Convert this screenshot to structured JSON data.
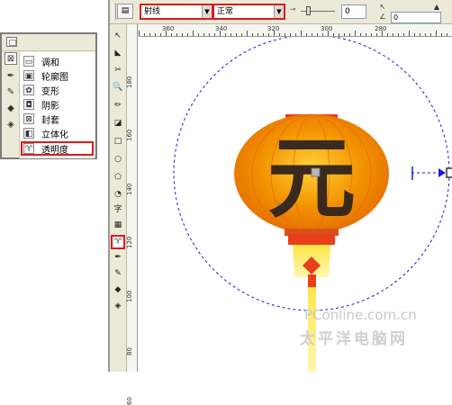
{
  "flyout": {
    "items": [
      {
        "label": "调和",
        "icon": "blend-icon",
        "glyph": "▭"
      },
      {
        "label": "轮廓图",
        "icon": "contour-icon",
        "glyph": "▣"
      },
      {
        "label": "变形",
        "icon": "distort-icon",
        "glyph": "✿"
      },
      {
        "label": "阴影",
        "icon": "shadow-icon",
        "glyph": "◘"
      },
      {
        "label": "封套",
        "icon": "envelope-icon",
        "glyph": "⊠"
      },
      {
        "label": "立体化",
        "icon": "extrude-icon",
        "glyph": "◧"
      },
      {
        "label": "透明度",
        "icon": "transparency-icon",
        "glyph": "♈"
      }
    ]
  },
  "propbar": {
    "type_select": "射线",
    "mode_select": "正常",
    "value_field": "0",
    "right_value": "0"
  },
  "ruler": {
    "h_ticks": [
      "360",
      "340",
      "320",
      "300",
      "280"
    ],
    "v_ticks": [
      "180",
      "160",
      "140",
      "120",
      "100",
      "80",
      "60"
    ]
  },
  "toolbox": {
    "text_tool_glyph": "字"
  },
  "lantern": {
    "character": "元",
    "body_color": "#f07a00",
    "highlight_color": "#ffd23a",
    "cap_color": "#e8401a"
  },
  "watermark": {
    "top": "PConline.com.cn",
    "bottom": "太平洋电脑网"
  }
}
